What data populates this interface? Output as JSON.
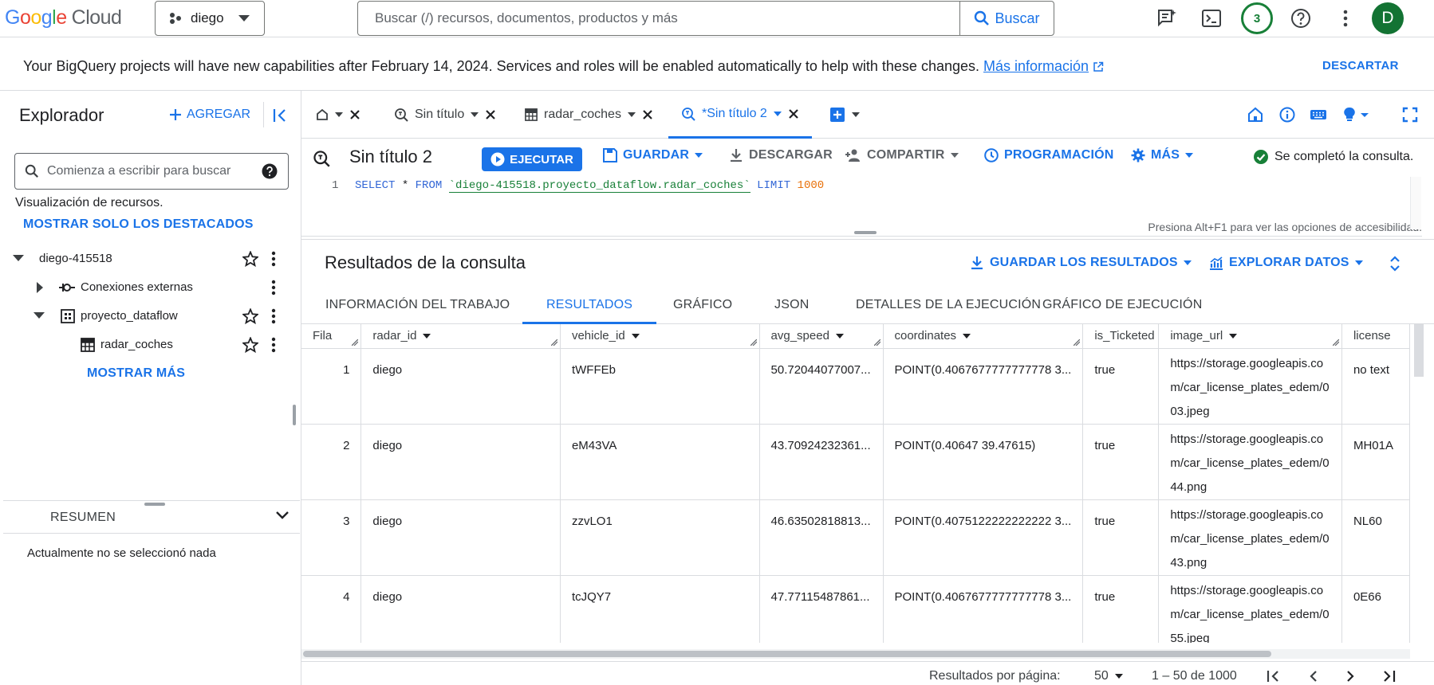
{
  "topbar": {
    "logo": {
      "G": "G",
      "o1": "o",
      "o2": "o",
      "g": "g",
      "l": "l",
      "e": "e",
      "cloud": "Cloud"
    },
    "project": "diego",
    "search_placeholder": "Buscar (/) recursos, documentos, productos y más",
    "search_button": "Buscar",
    "notifications_count": "3",
    "avatar_initial": "D"
  },
  "banner": {
    "message": "Your BigQuery projects will have new capabilities after February 14, 2024. Services and roles will be enabled automatically to help with these changes.",
    "link": "Más información",
    "dismiss": "DESCARTAR"
  },
  "explorer": {
    "title": "Explorador",
    "add_button": "AGREGAR",
    "search_placeholder": "Comienza a escribir para buscar",
    "resources_label": "Visualización de recursos.",
    "starred_only_link": "MOSTRAR SOLO LOS DESTACADOS",
    "tree": [
      {
        "label": "diego-415518"
      },
      {
        "label": "Conexiones externas"
      },
      {
        "label": "proyecto_dataflow"
      },
      {
        "label": "radar_coches"
      }
    ],
    "show_more": "MOSTRAR MÁS",
    "summary_label": "RESUMEN",
    "summary_text": "Actualmente no se seleccionó nada"
  },
  "tabs": [
    {
      "label": ""
    },
    {
      "label": "Sin título"
    },
    {
      "label": "radar_coches"
    },
    {
      "label": "*Sin título 2"
    }
  ],
  "query_toolbar": {
    "title": "Sin título 2",
    "run": "EJECUTAR",
    "save": "GUARDAR",
    "download": "DESCARGAR",
    "share": "COMPARTIR",
    "schedule": "PROGRAMACIÓN",
    "more": "MÁS",
    "status": "Se completó la consulta."
  },
  "editor": {
    "line_number": "1",
    "select_kw": "SELECT",
    "star": " * ",
    "from_kw": "FROM",
    "table": "`diego-415518.proyecto_dataflow.radar_coches`",
    "limit_kw": "LIMIT",
    "limit_value": "1000",
    "accessibility_hint": "Presiona Alt+F1 para ver las opciones de accesibilidad."
  },
  "results": {
    "title": "Resultados de la consulta",
    "save_results": "GUARDAR LOS RESULTADOS",
    "explore_data": "EXPLORAR DATOS",
    "tabs": [
      "INFORMACIÓN DEL TRABAJO",
      "RESULTADOS",
      "GRÁFICO",
      "JSON",
      "DETALLES DE LA EJECUCIÓN",
      "GRÁFICO DE EJECUCIÓN"
    ],
    "columns": [
      "Fila",
      "radar_id",
      "vehicle_id",
      "avg_speed",
      "coordinates",
      "is_Ticketed",
      "image_url",
      "license"
    ],
    "rows": [
      {
        "fila": "1",
        "radar_id": "diego",
        "vehicle_id": "tWFFEb",
        "avg_speed": "50.72044077007...",
        "coordinates": "POINT(0.4067677777777778 3...",
        "is_ticketed": "true",
        "image_url": "https://storage.googleapis.com/car_license_plates_edem/003.jpeg",
        "license": "no text"
      },
      {
        "fila": "2",
        "radar_id": "diego",
        "vehicle_id": "eM43VA",
        "avg_speed": "43.70924232361...",
        "coordinates": "POINT(0.40647 39.47615)",
        "is_ticketed": "true",
        "image_url": "https://storage.googleapis.com/car_license_plates_edem/044.png",
        "license": "MH01A"
      },
      {
        "fila": "3",
        "radar_id": "diego",
        "vehicle_id": "zzvLO1",
        "avg_speed": "46.63502818813...",
        "coordinates": "POINT(0.4075122222222222 3...",
        "is_ticketed": "true",
        "image_url": "https://storage.googleapis.com/car_license_plates_edem/043.png",
        "license": "NL60"
      },
      {
        "fila": "4",
        "radar_id": "diego",
        "vehicle_id": "tcJQY7",
        "avg_speed": "47.77115487861...",
        "coordinates": "POINT(0.4067677777777778 3...",
        "is_ticketed": "true",
        "image_url": "https://storage.googleapis.com/car_license_plates_edem/055.jpeg",
        "license": "0E66"
      }
    ]
  },
  "pager": {
    "per_page_label": "Resultados por página:",
    "per_page": "50",
    "range": "1 – 50 de 1000"
  },
  "colors": {
    "accent": "#1a73e8",
    "success": "#188038",
    "avatar": "#137333"
  }
}
